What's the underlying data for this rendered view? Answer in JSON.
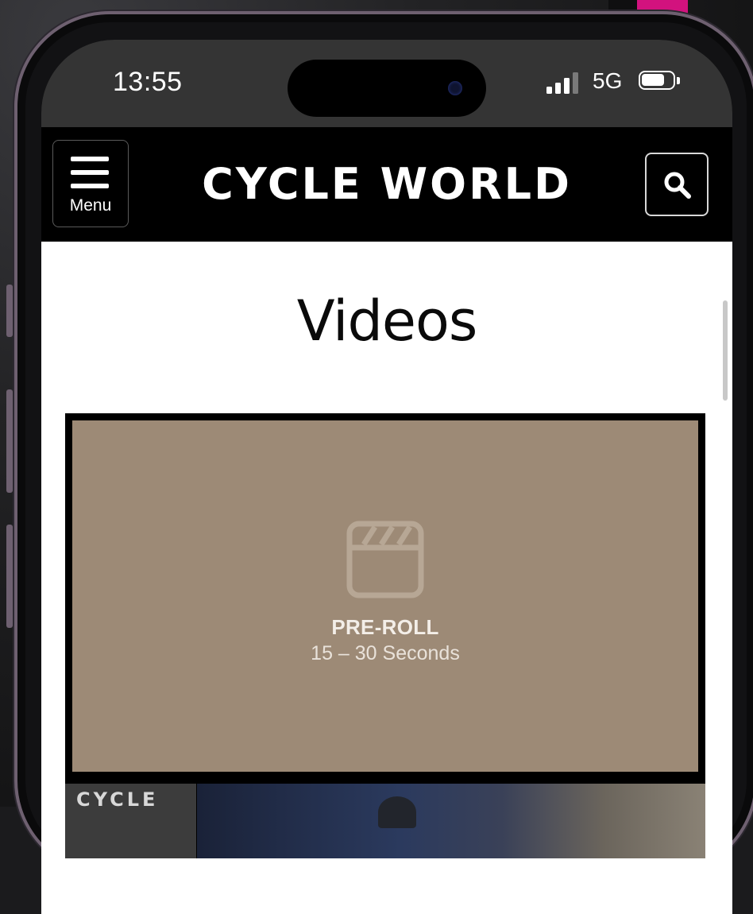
{
  "status_bar": {
    "time": "13:55",
    "network": "5G",
    "signal_bars_active": 3,
    "signal_bars_total": 4,
    "battery_level": 0.75
  },
  "header": {
    "menu_label": "Menu",
    "logo_text": "CYCLE WORLD",
    "menu_icon": "hamburger-icon",
    "search_icon": "search-icon"
  },
  "main": {
    "page_title": "Videos",
    "video": {
      "ad_label": "PRE-ROLL",
      "ad_duration": "15 – 30 Seconds",
      "placeholder_icon": "clapperboard-icon"
    },
    "next_thumb": {
      "brand_text": "CYCLE"
    }
  },
  "colors": {
    "header_bg": "#000000",
    "status_bar_bg": "#343434",
    "video_placeholder": "#9d8a76",
    "accent_magenta": "#d2127e"
  }
}
